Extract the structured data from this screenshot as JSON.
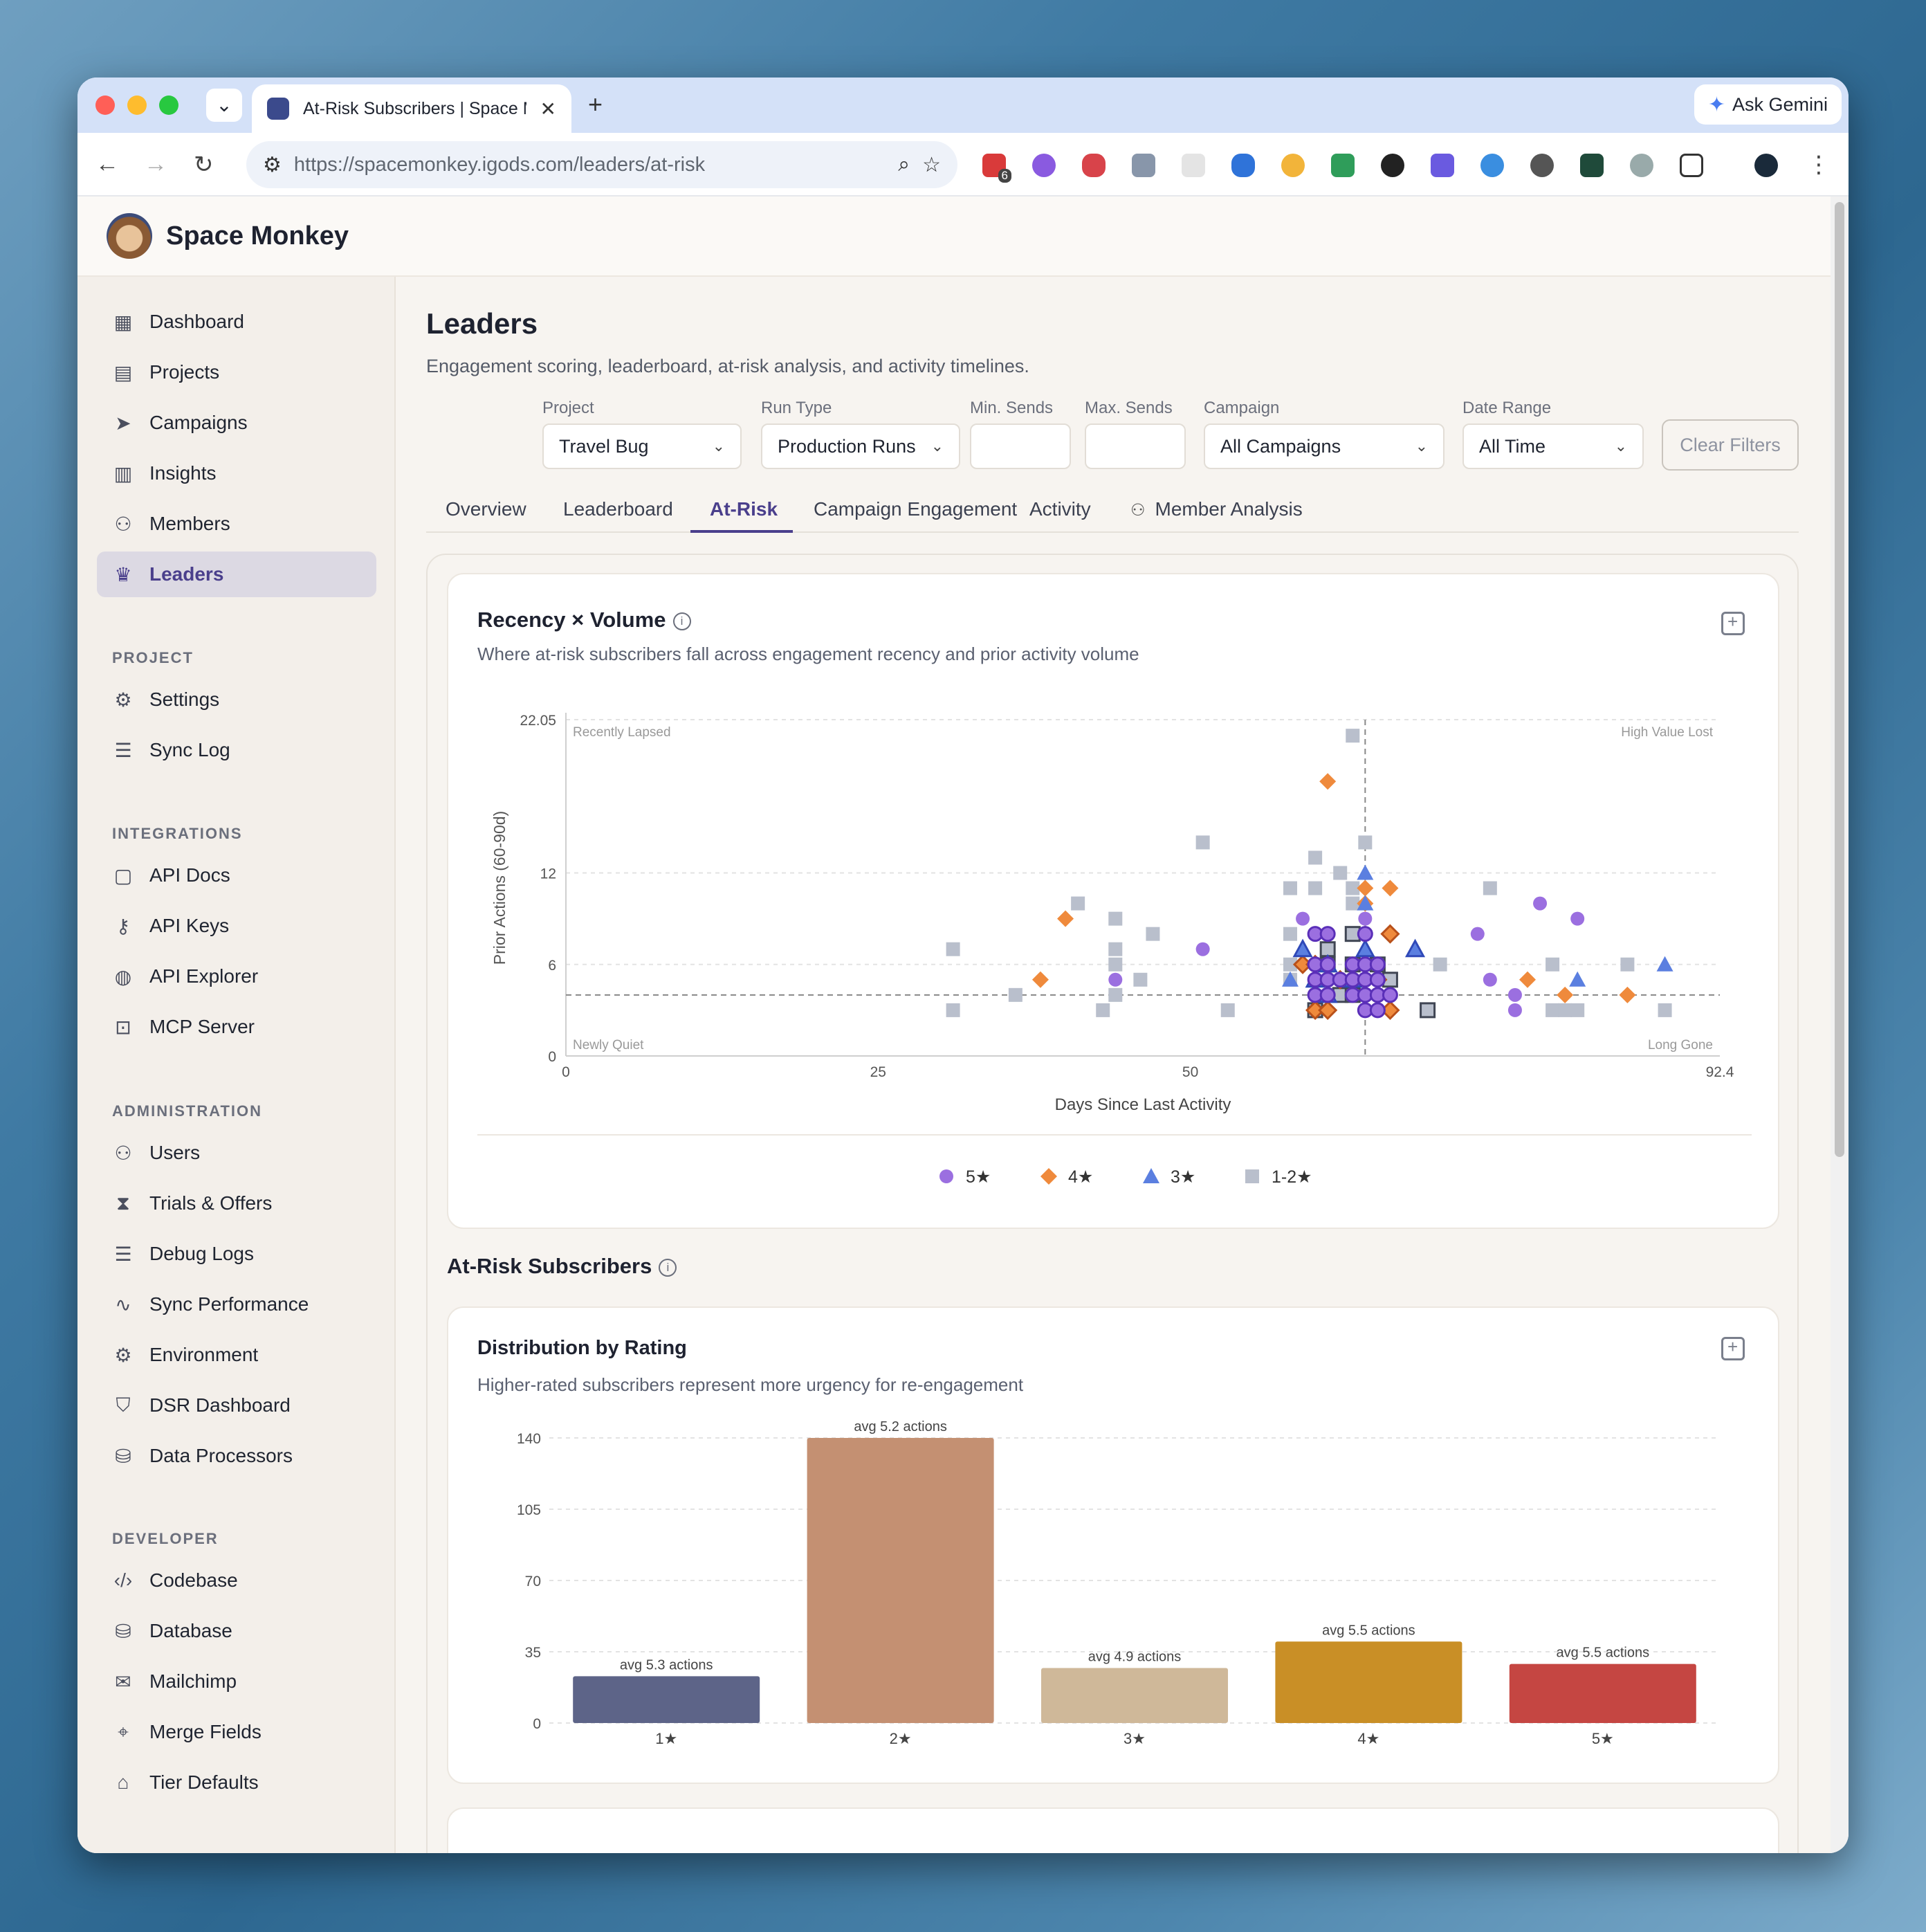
{
  "browser": {
    "tab_title": "At-Risk Subscribers | Space Monkey",
    "url_host": "https://spacemonkey.igods.com",
    "url_path": "/leaders/at-risk",
    "gemini_label": "Ask Gemini",
    "ext_badge": "6"
  },
  "app": {
    "brand": "Space Monkey"
  },
  "sidebar": {
    "main": [
      {
        "label": "Dashboard",
        "icon": "dashboard-icon"
      },
      {
        "label": "Projects",
        "icon": "projects-icon"
      },
      {
        "label": "Campaigns",
        "icon": "send-icon"
      },
      {
        "label": "Insights",
        "icon": "bar-chart-icon"
      },
      {
        "label": "Members",
        "icon": "members-icon"
      },
      {
        "label": "Leaders",
        "icon": "crown-icon",
        "active": true
      }
    ],
    "project_title": "PROJECT",
    "project": [
      {
        "label": "Settings",
        "icon": "gear-icon"
      },
      {
        "label": "Sync Log",
        "icon": "log-icon"
      }
    ],
    "integrations_title": "INTEGRATIONS",
    "integrations": [
      {
        "label": "API Docs",
        "icon": "book-icon"
      },
      {
        "label": "API Keys",
        "icon": "key-icon"
      },
      {
        "label": "API Explorer",
        "icon": "globe-icon"
      },
      {
        "label": "MCP Server",
        "icon": "robot-icon"
      }
    ],
    "administration_title": "ADMINISTRATION",
    "administration": [
      {
        "label": "Users",
        "icon": "users-icon"
      },
      {
        "label": "Trials & Offers",
        "icon": "hourglass-icon"
      },
      {
        "label": "Debug Logs",
        "icon": "log-icon"
      },
      {
        "label": "Sync Performance",
        "icon": "pulse-icon"
      },
      {
        "label": "Environment",
        "icon": "cog-icon"
      },
      {
        "label": "DSR Dashboard",
        "icon": "shield-icon"
      },
      {
        "label": "Data Processors",
        "icon": "database-icon"
      }
    ],
    "developer_title": "DEVELOPER",
    "developer": [
      {
        "label": "Codebase",
        "icon": "code-icon"
      },
      {
        "label": "Database",
        "icon": "database-icon"
      },
      {
        "label": "Mailchimp",
        "icon": "mail-icon"
      },
      {
        "label": "Merge Fields",
        "icon": "tags-icon"
      },
      {
        "label": "Tier Defaults",
        "icon": "tag-icon"
      }
    ]
  },
  "page": {
    "title": "Leaders",
    "subtitle": "Engagement scoring, leaderboard, at-risk analysis, and activity timelines."
  },
  "filters": {
    "project": {
      "label": "Project",
      "value": "Travel Bug"
    },
    "run_type": {
      "label": "Run Type",
      "value": "Production Runs"
    },
    "min_sends": {
      "label": "Min. Sends",
      "value": ""
    },
    "max_sends": {
      "label": "Max. Sends",
      "value": ""
    },
    "campaign": {
      "label": "Campaign",
      "value": "All Campaigns"
    },
    "date_range": {
      "label": "Date Range",
      "value": "All Time"
    },
    "clear_label": "Clear Filters"
  },
  "tabs": [
    "Overview",
    "Leaderboard",
    "At-Risk",
    "Campaign Engagement",
    "Activity",
    "Member Analysis"
  ],
  "active_tab": "At-Risk",
  "scatter_card": {
    "title": "Recency × Volume",
    "subtitle": "Where at-risk subscribers fall across engagement recency and prior activity volume"
  },
  "section_title": "At-Risk Subscribers",
  "bar_card": {
    "title": "Distribution by Rating",
    "subtitle": "Higher-rated subscribers represent more urgency for re-engagement"
  },
  "colors": {
    "s5": "#9b6fe0",
    "s4": "#ef8a3c",
    "s3": "#5b7fe0",
    "s12": "#b9bfcc"
  },
  "chart_data": [
    {
      "type": "scatter",
      "xlabel": "Days Since Last Activity",
      "ylabel": "Prior Actions (60-90d)",
      "xlim": [
        0,
        92.4
      ],
      "ylim": [
        0,
        22.05
      ],
      "xticks": [
        "0",
        "25",
        "50",
        "92.4"
      ],
      "yticks": [
        "0",
        "6",
        "12",
        "22.05"
      ],
      "x_ref": 64,
      "y_ref": 4,
      "quadrants": {
        "top_left": "Recently Lapsed",
        "top_right": "High Value Lost",
        "bottom_left": "Newly Quiet",
        "bottom_right": "Long Gone"
      },
      "legend": [
        "5★",
        "4★",
        "3★",
        "1-2★"
      ],
      "series": [
        {
          "name": "5★",
          "marker": "circle",
          "points": [
            [
              51,
              7
            ],
            [
              59,
              9
            ],
            [
              60,
              8
            ],
            [
              61,
              8
            ],
            [
              64,
              9
            ],
            [
              64,
              8
            ],
            [
              60,
              6
            ],
            [
              61,
              6
            ],
            [
              63,
              6
            ],
            [
              64,
              6
            ],
            [
              65,
              6
            ],
            [
              60,
              5
            ],
            [
              61,
              5
            ],
            [
              62,
              5
            ],
            [
              63,
              5
            ],
            [
              64,
              5
            ],
            [
              65,
              5
            ],
            [
              60,
              4
            ],
            [
              61,
              4
            ],
            [
              63,
              4
            ],
            [
              64,
              4
            ],
            [
              65,
              4
            ],
            [
              66,
              4
            ],
            [
              64,
              3
            ],
            [
              65,
              3
            ],
            [
              44,
              5
            ],
            [
              74,
              5
            ],
            [
              73,
              8
            ],
            [
              78,
              10
            ],
            [
              81,
              9
            ],
            [
              76,
              4
            ],
            [
              76,
              3
            ]
          ]
        },
        {
          "name": "4★",
          "marker": "diamond",
          "points": [
            [
              61,
              18
            ],
            [
              40,
              9
            ],
            [
              38,
              5
            ],
            [
              59,
              6
            ],
            [
              60,
              6
            ],
            [
              60,
              3
            ],
            [
              61,
              3
            ],
            [
              62,
              5
            ],
            [
              64,
              6
            ],
            [
              64,
              5
            ],
            [
              65,
              5
            ],
            [
              66,
              3
            ],
            [
              64,
              10
            ],
            [
              64,
              11
            ],
            [
              66,
              11
            ],
            [
              66,
              8
            ],
            [
              61,
              5
            ],
            [
              77,
              5
            ],
            [
              80,
              4
            ],
            [
              85,
              4
            ]
          ]
        },
        {
          "name": "3★",
          "marker": "triangle",
          "points": [
            [
              64,
              12
            ],
            [
              64,
              10
            ],
            [
              59,
              7
            ],
            [
              61,
              6
            ],
            [
              64,
              7
            ],
            [
              68,
              7
            ],
            [
              60,
              5
            ],
            [
              63,
              5
            ],
            [
              58,
              5
            ],
            [
              61,
              4
            ],
            [
              81,
              5
            ],
            [
              88,
              6
            ]
          ]
        },
        {
          "name": "1-2★",
          "marker": "square",
          "points": [
            [
              63,
              21
            ],
            [
              51,
              14
            ],
            [
              60,
              13
            ],
            [
              64,
              14
            ],
            [
              31,
              7
            ],
            [
              41,
              10
            ],
            [
              44,
              9
            ],
            [
              44,
              7
            ],
            [
              44,
              6
            ],
            [
              44,
              4
            ],
            [
              47,
              8
            ],
            [
              46,
              5
            ],
            [
              36,
              4
            ],
            [
              31,
              3
            ],
            [
              43,
              3
            ],
            [
              53,
              3
            ],
            [
              58,
              11
            ],
            [
              60,
              11
            ],
            [
              62,
              12
            ],
            [
              63,
              11
            ],
            [
              63,
              10
            ],
            [
              58,
              8
            ],
            [
              61,
              7
            ],
            [
              63,
              8
            ],
            [
              58,
              6
            ],
            [
              61,
              6
            ],
            [
              63,
              6
            ],
            [
              65,
              6
            ],
            [
              66,
              5
            ],
            [
              58,
              5
            ],
            [
              62,
              4
            ],
            [
              60,
              3
            ],
            [
              70,
              6
            ],
            [
              69,
              3
            ],
            [
              74,
              11
            ],
            [
              79,
              6
            ],
            [
              79,
              3
            ],
            [
              80,
              3
            ],
            [
              81,
              3
            ],
            [
              85,
              6
            ],
            [
              88,
              3
            ],
            [
              63,
              4
            ]
          ]
        }
      ]
    },
    {
      "type": "bar",
      "categories": [
        "1★",
        "2★",
        "3★",
        "4★",
        "5★"
      ],
      "values": [
        23,
        140,
        27,
        40,
        29
      ],
      "labels": [
        "avg 5.3 actions",
        "avg 5.2 actions",
        "avg 4.9 actions",
        "avg 5.5 actions",
        "avg 5.5 actions"
      ],
      "colors": [
        "#5d6488",
        "#c49072",
        "#cfb899",
        "#c98f26",
        "#c54642"
      ],
      "ylim": [
        0,
        140
      ],
      "yticks": [
        "0",
        "35",
        "70",
        "105",
        "140"
      ]
    }
  ]
}
